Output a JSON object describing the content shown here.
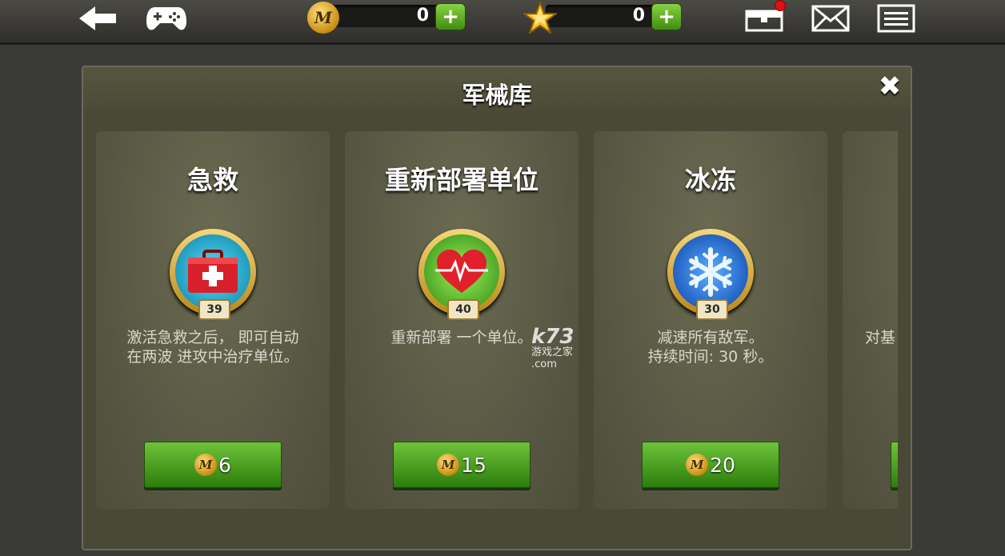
{
  "topbar": {
    "coin_count": "0",
    "coin_plus": "+",
    "coin_emblem": "M",
    "star_count": "0",
    "star_plus": "+",
    "has_notification": true
  },
  "icons": {
    "back": "back-arrow-icon",
    "gamepad": "gamepad-icon",
    "chest": "treasure-chest-icon",
    "mail": "mail-icon",
    "menu": "menu-icon",
    "close": "close-icon"
  },
  "panel": {
    "title": "军械库",
    "close": "✖"
  },
  "cards": [
    {
      "title": "急救",
      "level": "39",
      "description": "激活急救之后， 即可自动\n在两波 进攻中治疗单位。",
      "price": "6",
      "icon": "first-aid-kit-icon"
    },
    {
      "title": "重新部署单位",
      "level": "40",
      "description": "重新部署 一个单位。",
      "price": "15",
      "icon": "heart-pulse-icon"
    },
    {
      "title": "冰冻",
      "level": "30",
      "description": "减速所有敌军。\n持续时间: 30 秒。",
      "price": "20",
      "icon": "snowflake-icon"
    },
    {
      "title": "",
      "level": "",
      "description": "对基",
      "price": "",
      "icon": ""
    }
  ],
  "watermark": {
    "logo": "k73",
    "site": "游戏之家",
    "domain": ".com"
  },
  "colors": {
    "button_green": "#4ea522",
    "panel_bg": "#4a4836",
    "card_bg": "#5c5b46",
    "gold": "#d9a829"
  }
}
